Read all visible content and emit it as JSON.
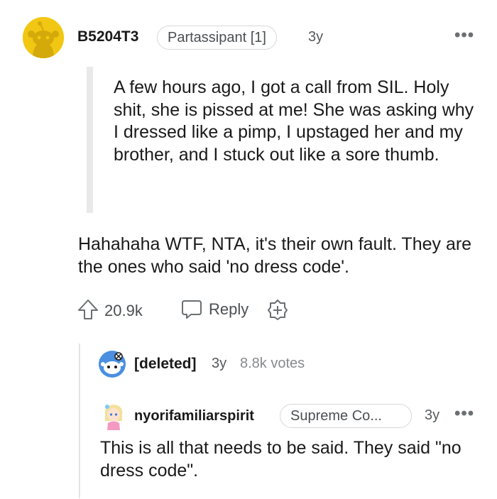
{
  "comment": {
    "username": "B5204T3",
    "flair": "Partassipant [1]",
    "age": "3y",
    "more_label": "•••",
    "quote": "A few hours ago, I got a call from SIL. Holy shit, she is pissed at me! She was asking why I dressed like a pimp, I upstaged her and my brother, and I stuck out like a sore thumb.",
    "body": "Hahahaha WTF, NTA, it's their own fault. They are the ones who said 'no dress code'.",
    "votes": "20.9k",
    "reply_label": "Reply",
    "avatar_color": "#f2c713"
  },
  "deleted_comment": {
    "username": "[deleted]",
    "age": "3y",
    "votes": "8.8k votes"
  },
  "reply": {
    "username": "nyorifamiliarspirit",
    "flair": "Supreme Co...",
    "age": "3y",
    "more_label": "•••",
    "body": "This is all that needs to be said. They said \"no dress code\"."
  },
  "icons": [
    "user-avatar-icon",
    "more-options-icon",
    "upvote-icon",
    "reply-icon",
    "award-icon",
    "deleted-avatar-icon",
    "anime-avatar-icon"
  ]
}
